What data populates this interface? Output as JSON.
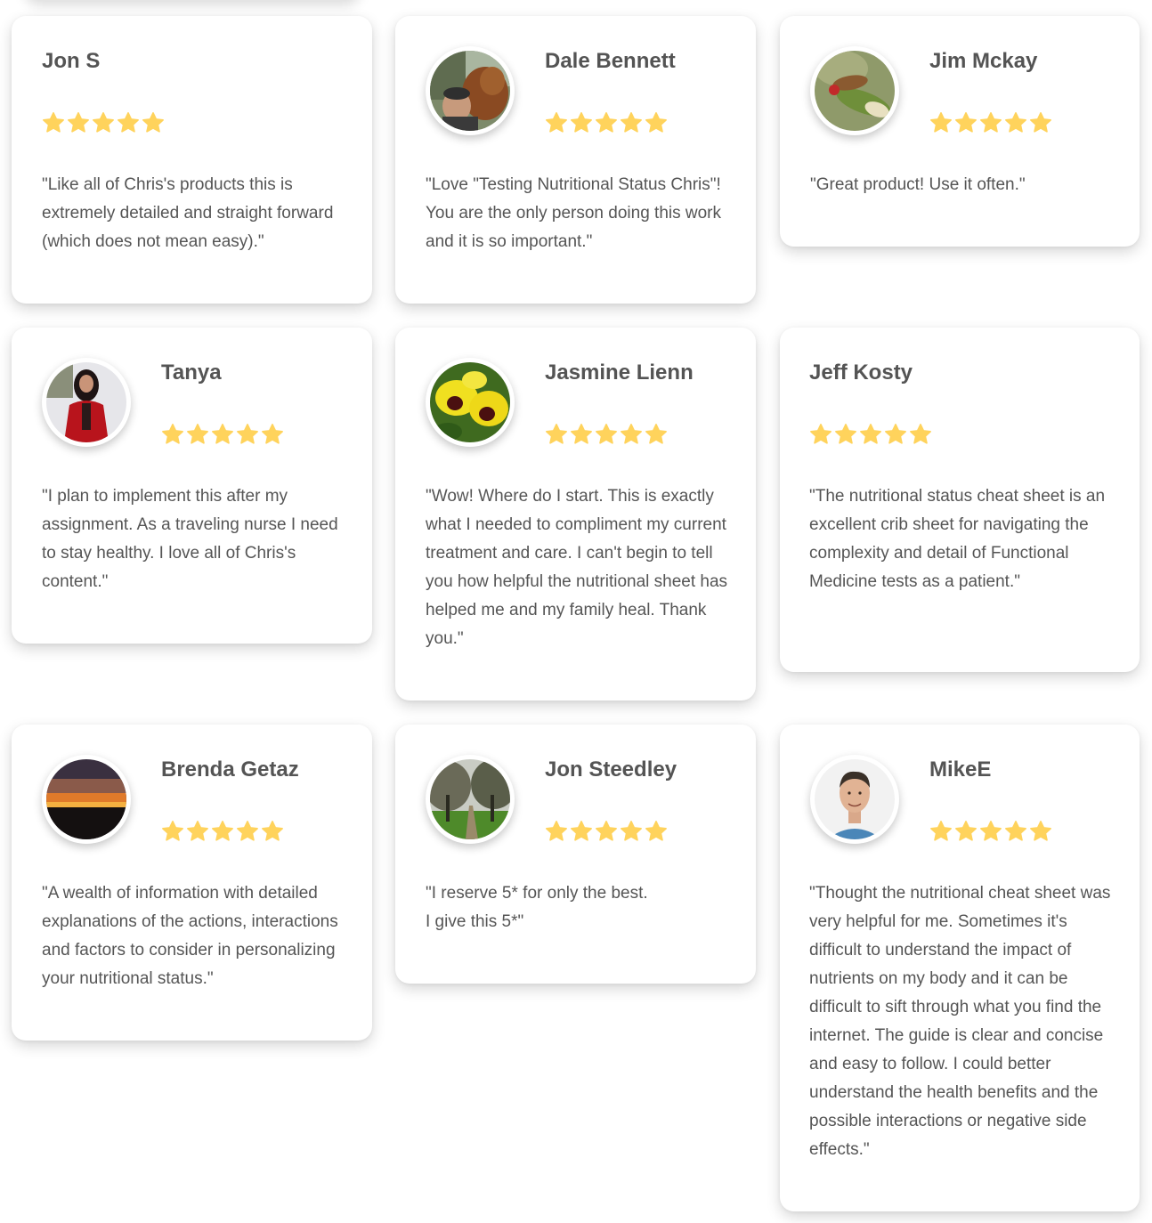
{
  "colors": {
    "star": "#FFD35C",
    "name_text": "#545454",
    "body_text": "#555555",
    "card_bg": "#FFFFFF"
  },
  "reviews": [
    {
      "name": "Jon S",
      "rating": 5,
      "avatar": null,
      "quote": "\"Like all of Chris's products this is extremely detailed and straight forward (which does not mean easy).\""
    },
    {
      "name": "Dale Bennett",
      "rating": 5,
      "avatar": "man-with-dog-photo",
      "quote": "\"Love \"Testing Nutritional Status Chris\"! You are the only person doing this work and it is so important.\""
    },
    {
      "name": "Jim Mckay",
      "rating": 5,
      "avatar": "weasel-on-woodpecker-photo",
      "quote": "\"Great product! Use it often.\""
    },
    {
      "name": "Tanya",
      "rating": 5,
      "avatar": "woman-in-red-dress-photo",
      "quote": "\"I plan to implement this after my assignment. As a traveling nurse I need to stay healthy. I love all of Chris's content.\""
    },
    {
      "name": "Jasmine Lienn",
      "rating": 5,
      "avatar": "yellow-pansy-photo",
      "quote": "\"Wow!  Where do I start.  This is exactly what I needed to compliment my current treatment and care.  I can't begin to tell you how helpful the nutritional sheet has helped me  and my family heal. Thank you.\""
    },
    {
      "name": "Jeff Kosty",
      "rating": 5,
      "avatar": null,
      "quote": "\"The nutritional status cheat sheet is an excellent crib sheet for navigating the complexity and detail of Functional Medicine tests as a patient.\""
    },
    {
      "name": "Brenda Getaz",
      "rating": 5,
      "avatar": "sunset-photo",
      "quote": "\"A wealth of information with detailed explanations of the actions, interactions and factors to consider in personalizing your nutritional status.\""
    },
    {
      "name": "Jon Steedley",
      "rating": 5,
      "avatar": "tree-lined-path-photo",
      "quote": "\"I reserve 5* for only the best.\nI give this 5*\""
    },
    {
      "name": "MikeE",
      "rating": 5,
      "avatar": "man-portrait-photo",
      "quote": "\"Thought the nutritional cheat sheet was very helpful for me.  Sometimes it's difficult to understand the impact of nutrients on my body and it can be difficult to sift through what you find the internet.  The guide is clear and concise and easy to follow.  I could better understand the health benefits and the possible interactions or negative side effects.\""
    }
  ]
}
